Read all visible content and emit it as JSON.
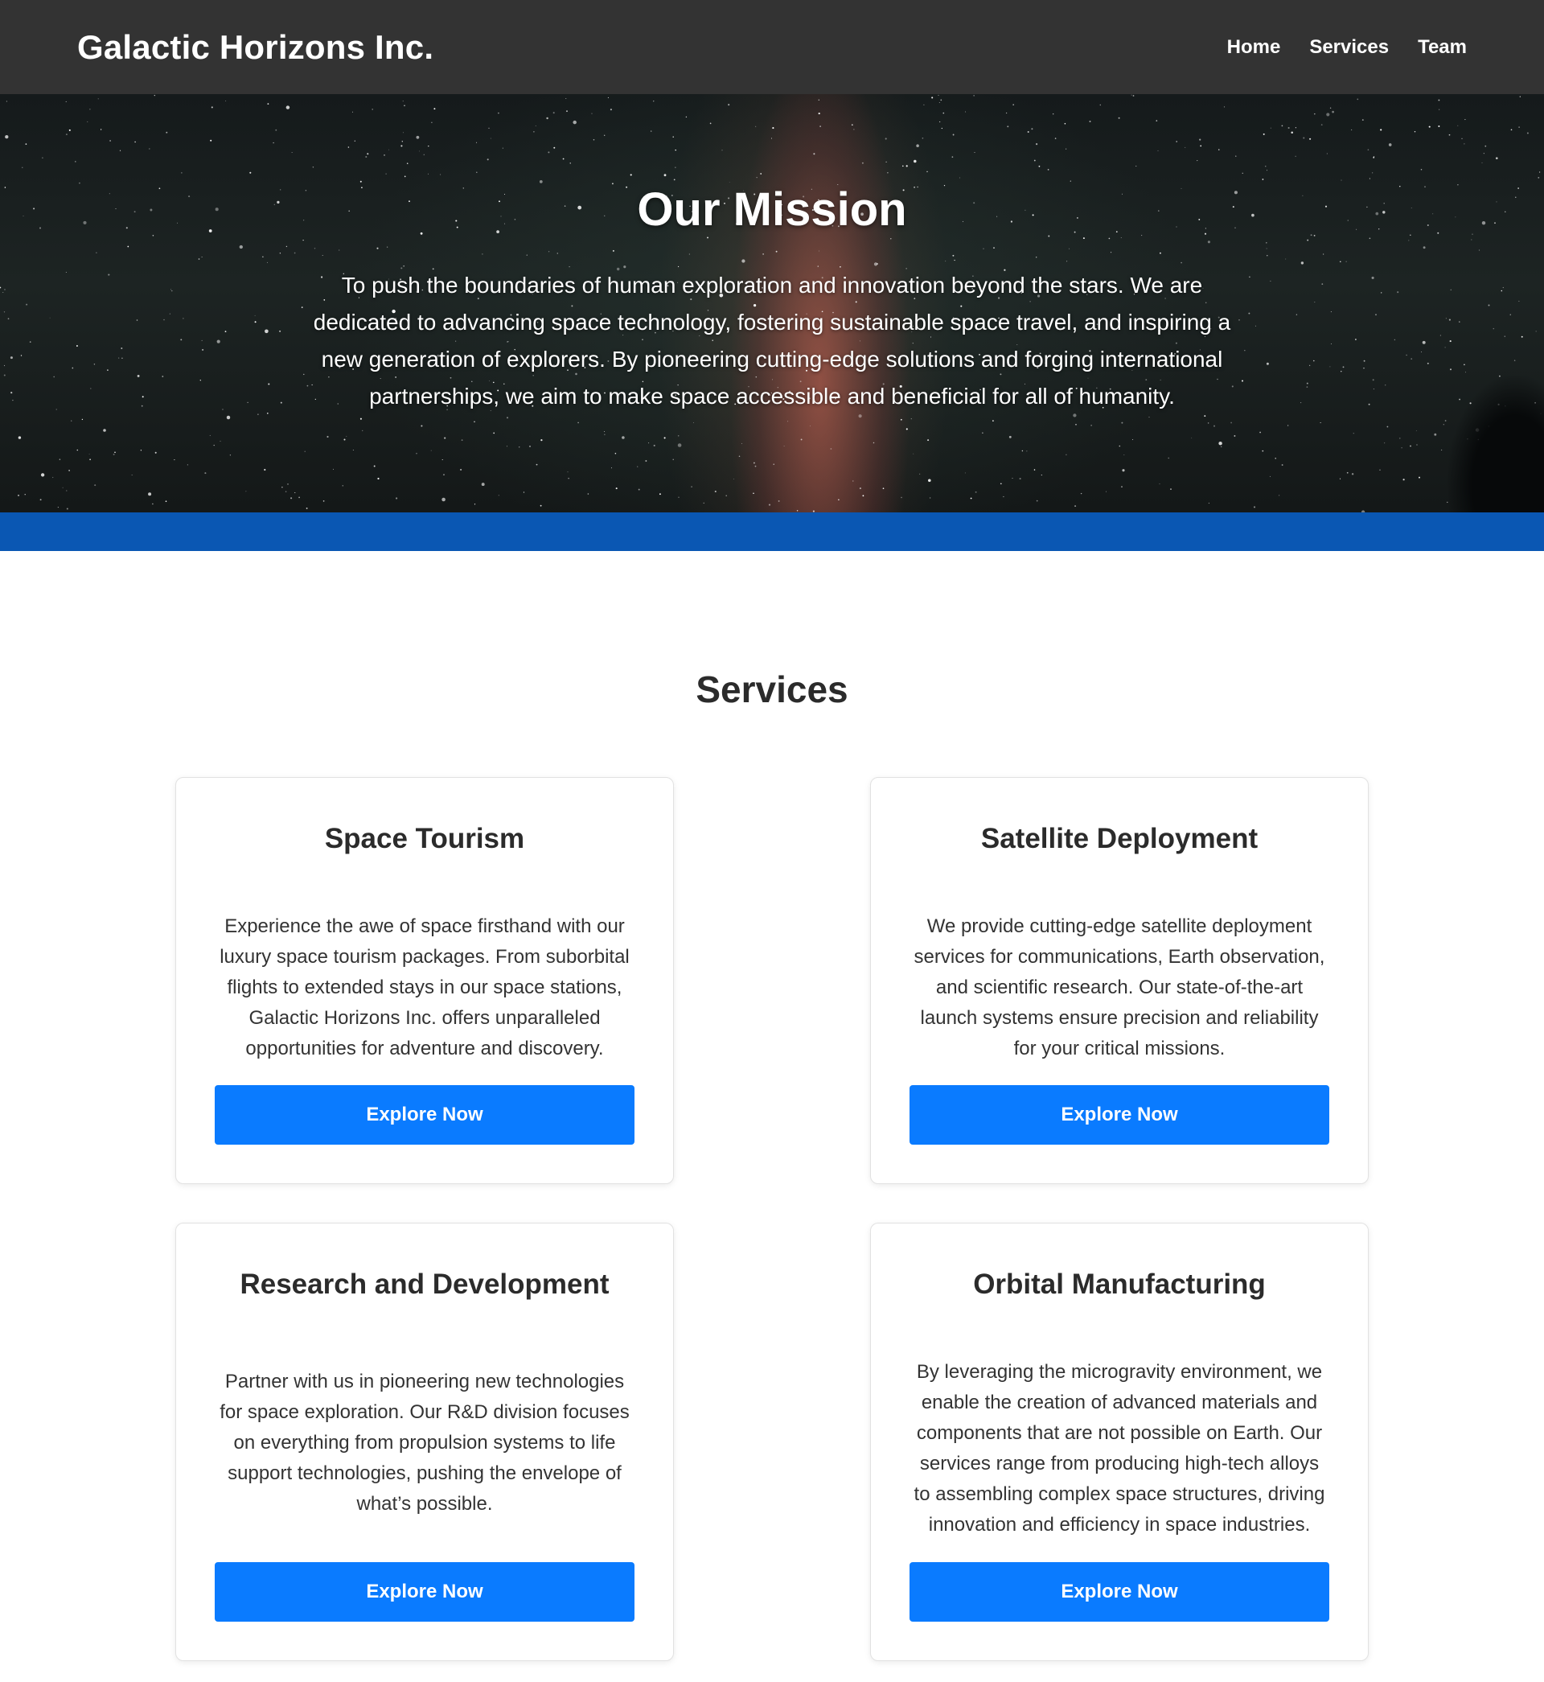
{
  "header": {
    "brand": "Galactic Horizons Inc.",
    "nav": [
      {
        "label": "Home"
      },
      {
        "label": "Services"
      },
      {
        "label": "Team"
      }
    ]
  },
  "hero": {
    "title": "Our Mission",
    "text": "To push the boundaries of human exploration and innovation beyond the stars. We are dedicated to advancing space technology, fostering sustainable space travel, and inspiring a new generation of explorers. By pioneering cutting-edge solutions and forging international partnerships, we aim to make space accessible and beneficial for all of humanity."
  },
  "services": {
    "title": "Services",
    "cards": [
      {
        "title": "Space Tourism",
        "text": "Experience the awe of space firsthand with our luxury space tourism packages. From suborbital flights to extended stays in our space stations, Galactic Horizons Inc. offers unparalleled opportunities for adventure and discovery.",
        "button": "Explore Now"
      },
      {
        "title": "Satellite Deployment",
        "text": "We provide cutting-edge satellite deployment services for communications, Earth observation, and scientific research. Our state-of-the-art launch systems ensure precision and reliability for your critical missions.",
        "button": "Explore Now"
      },
      {
        "title": "Research and Development",
        "text": "Partner with us in pioneering new technologies for space exploration. Our R&D division focuses on everything from propulsion systems to life support technologies, pushing the envelope of what’s possible.",
        "button": "Explore Now"
      },
      {
        "title": "Orbital Manufacturing",
        "text": "By leveraging the microgravity environment, we enable the creation of advanced materials and components that are not possible on Earth. Our services range from producing high-tech alloys to assembling complex space structures, driving innovation and efficiency in space industries.",
        "button": "Explore Now"
      }
    ]
  },
  "colors": {
    "header_bg": "#333333",
    "band_blue": "#0a57b3",
    "button_blue": "#0a7bff"
  }
}
